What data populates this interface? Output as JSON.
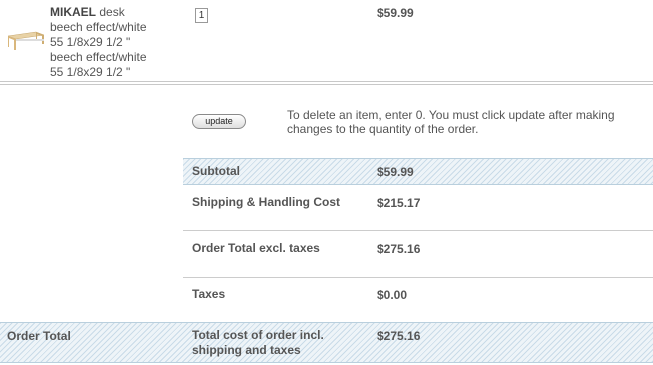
{
  "product": {
    "name": "MIKAEL",
    "type": "desk",
    "description_line1": "beech effect/white",
    "description_line2": "55 1/8x29 1/2 \"",
    "description_line3": "beech effect/white",
    "description_line4": "55 1/8x29 1/2 \"",
    "quantity": "1",
    "price": "$59.99"
  },
  "update": {
    "button_label": "update",
    "note": "To delete an item, enter 0. You must click update after making changes to the quantity of the order."
  },
  "summary": {
    "subtotal_label": "Subtotal",
    "subtotal_value": "$59.99",
    "shipping_label": "Shipping & Handling Cost",
    "shipping_value": "$215.17",
    "order_total_excl_label": "Order Total excl. taxes",
    "order_total_excl_value": "$275.16",
    "taxes_label": "Taxes",
    "taxes_value": "$0.00",
    "order_total_heading": "Order Total",
    "total_incl_label_line1": "Total cost of order incl.",
    "total_incl_label_line2": "shipping and taxes",
    "total_incl_value": "$275.16"
  },
  "colors": {
    "text": "#555555",
    "hatch": "#c9dbe8",
    "rule": "#cccccc"
  }
}
